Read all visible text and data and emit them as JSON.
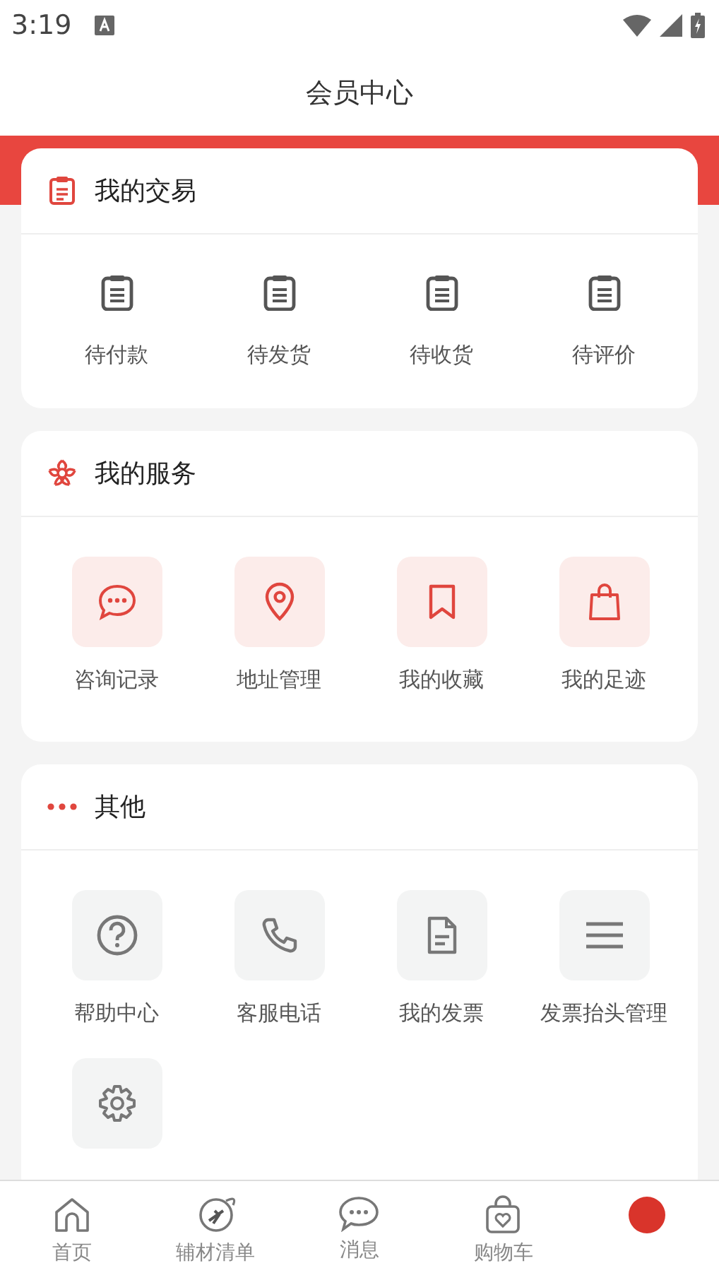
{
  "status_bar": {
    "time": "3:19"
  },
  "header": {
    "title": "会员中心"
  },
  "trade": {
    "title": "我的交易",
    "items": [
      {
        "label": "待付款"
      },
      {
        "label": "待发货"
      },
      {
        "label": "待收货"
      },
      {
        "label": "待评价"
      }
    ]
  },
  "services": {
    "title": "我的服务",
    "items": [
      {
        "label": "咨询记录"
      },
      {
        "label": "地址管理"
      },
      {
        "label": "我的收藏"
      },
      {
        "label": "我的足迹"
      }
    ]
  },
  "other": {
    "title": "其他",
    "items": [
      {
        "kind": "labeled",
        "label": "帮助中心"
      },
      {
        "kind": "labeled",
        "label": "客服电话"
      },
      {
        "kind": "labeled",
        "label": "我的发票"
      },
      {
        "kind": "labeled",
        "label": "发票抬头管理"
      },
      {
        "kind": "icon_only"
      }
    ]
  },
  "bottom_nav": [
    {
      "kind": "labeled",
      "label": "首页"
    },
    {
      "kind": "labeled",
      "label": "辅材清单"
    },
    {
      "kind": "labeled",
      "label": "消息"
    },
    {
      "kind": "labeled",
      "label": "购物车"
    },
    {
      "kind": "icon_only"
    }
  ]
}
